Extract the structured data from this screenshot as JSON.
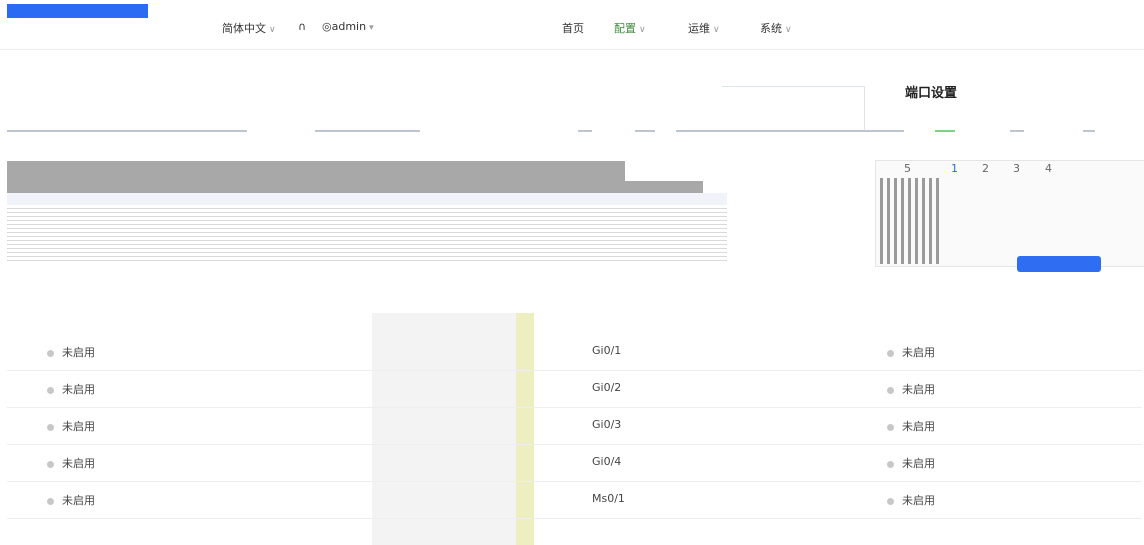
{
  "nav": {
    "language": "简体中文",
    "user": "admin",
    "menu": [
      {
        "label": "首页"
      },
      {
        "label": "配置"
      },
      {
        "label": "运维"
      },
      {
        "label": "系统"
      }
    ]
  },
  "page": {
    "title": "端口设置"
  },
  "tabs": [
    "5",
    "1",
    "2",
    "3",
    "4"
  ],
  "ports": [
    {
      "name": "Gi0/1",
      "left_status": "未启用",
      "right_status": "未启用"
    },
    {
      "name": "Gi0/2",
      "left_status": "未启用",
      "right_status": "未启用"
    },
    {
      "name": "Gi0/3",
      "left_status": "未启用",
      "right_status": "未启用"
    },
    {
      "name": "Gi0/4",
      "left_status": "未启用",
      "right_status": "未启用"
    },
    {
      "name": "Ms0/1",
      "left_status": "未启用",
      "right_status": "未启用"
    }
  ]
}
